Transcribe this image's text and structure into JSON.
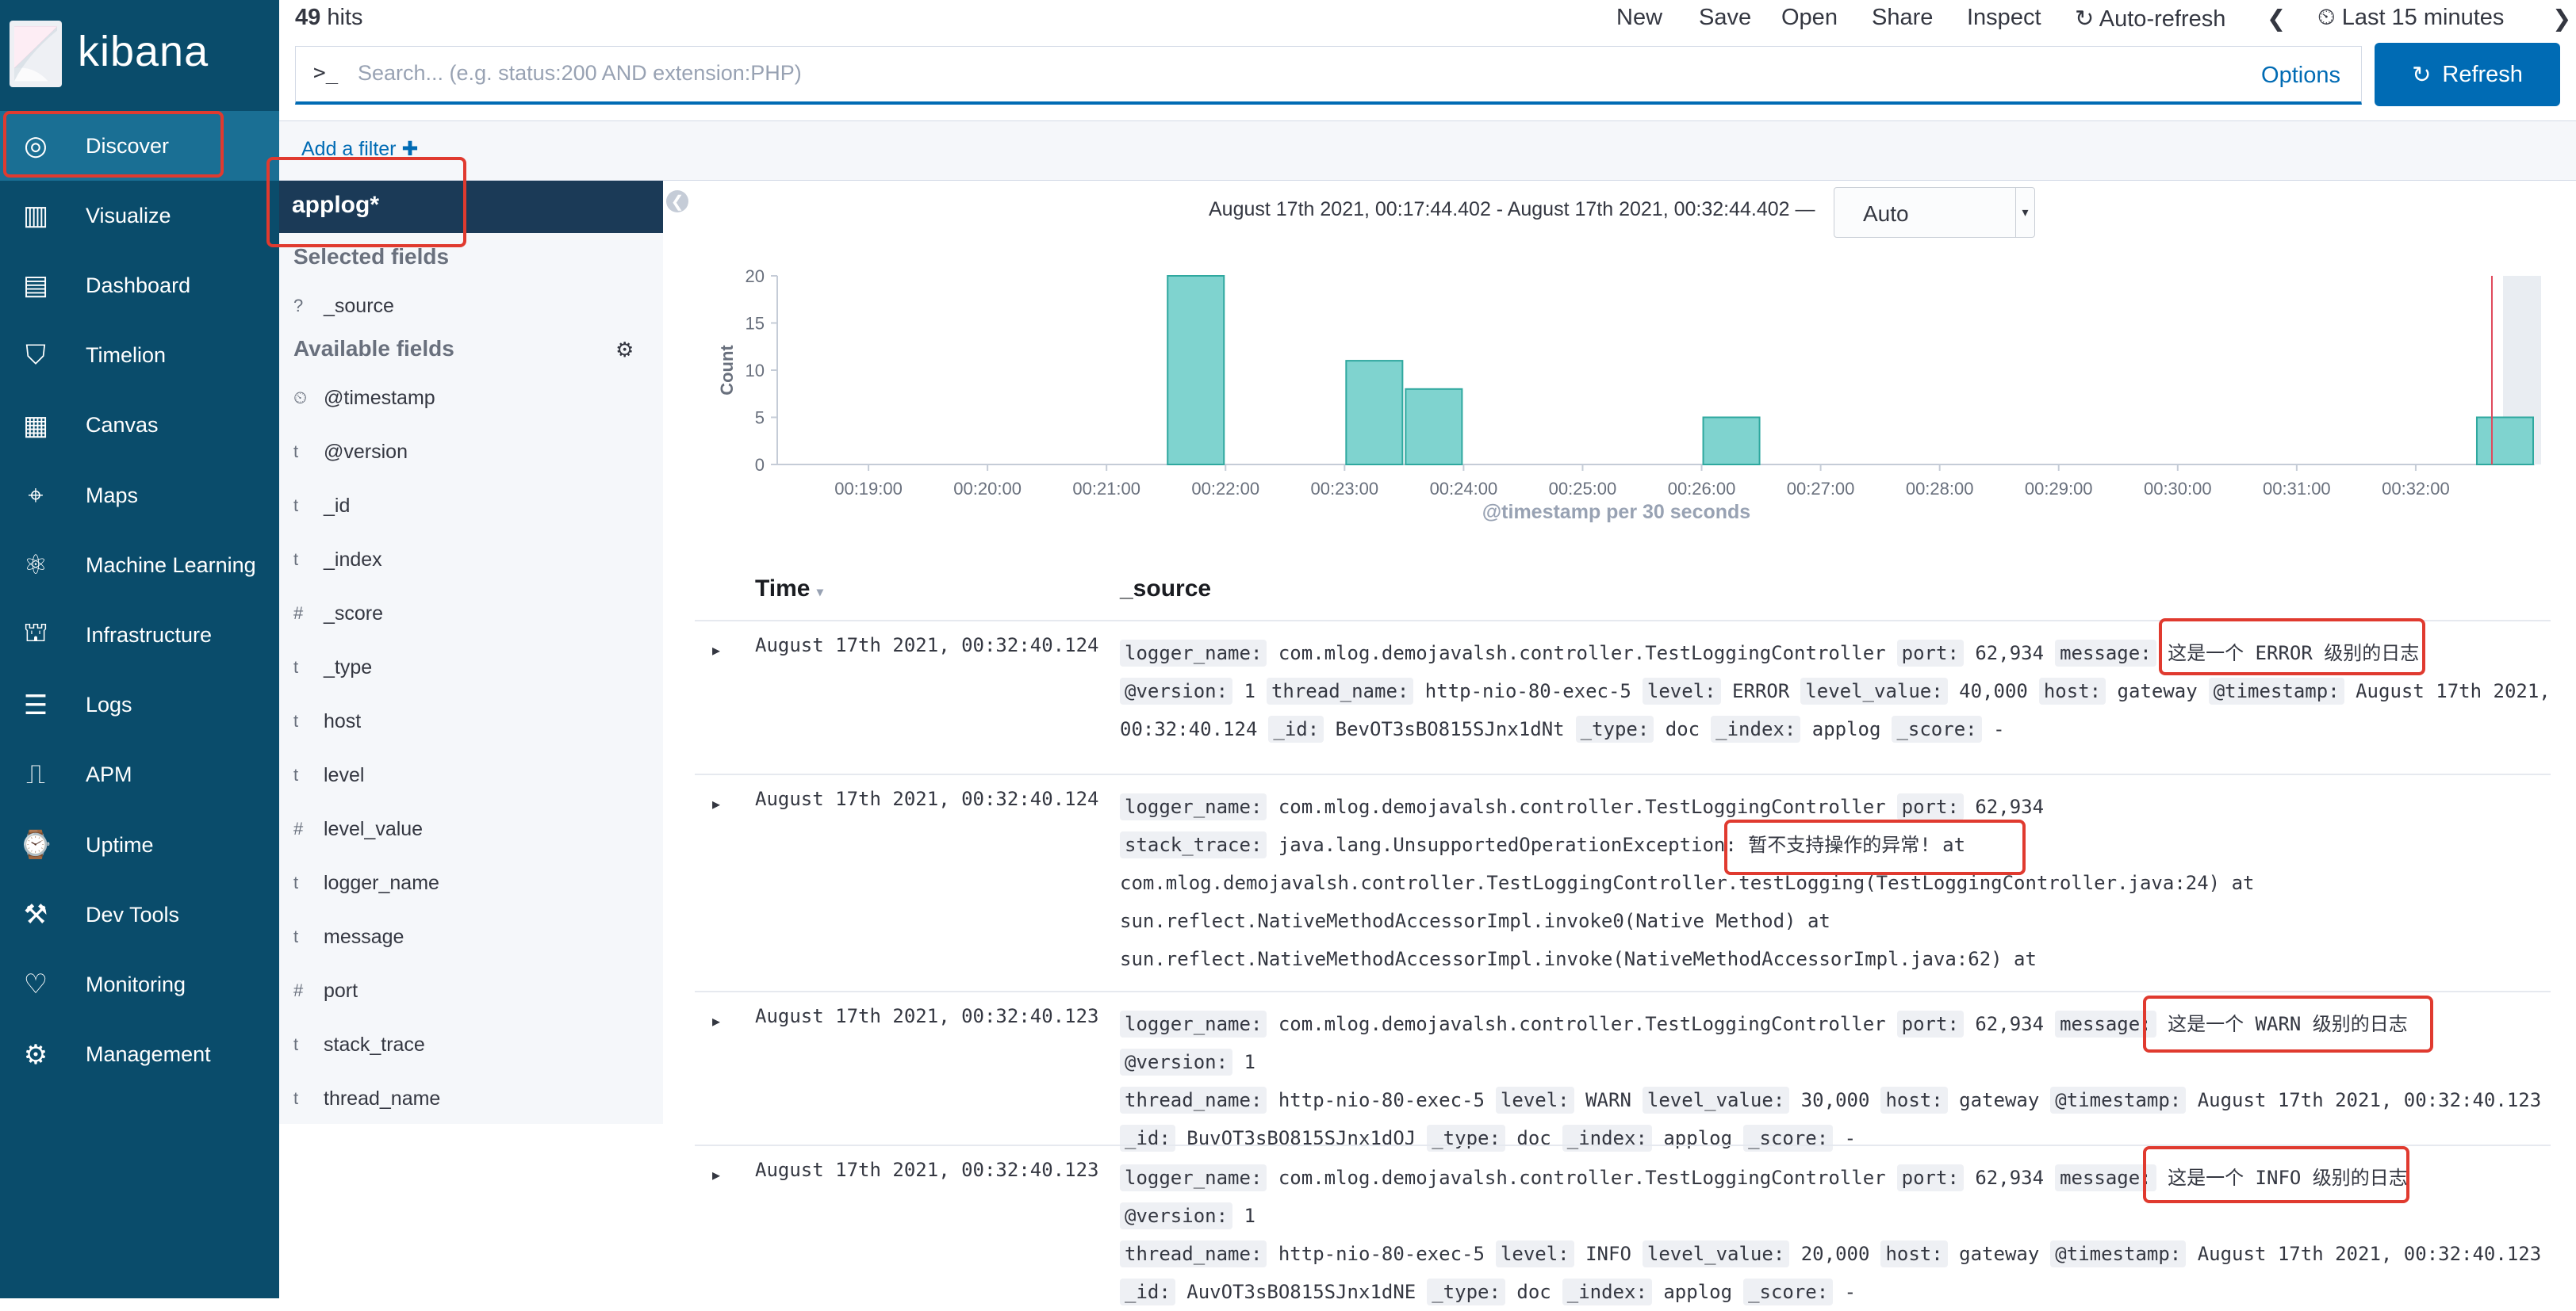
{
  "nav": {
    "logo_text": "kibana",
    "items": [
      {
        "label": "Discover",
        "icon": "compass-icon"
      },
      {
        "label": "Visualize",
        "icon": "visualize-icon"
      },
      {
        "label": "Dashboard",
        "icon": "dashboard-icon"
      },
      {
        "label": "Timelion",
        "icon": "timelion-icon"
      },
      {
        "label": "Canvas",
        "icon": "canvas-icon"
      },
      {
        "label": "Maps",
        "icon": "maps-icon"
      },
      {
        "label": "Machine Learning",
        "icon": "machine-learning-icon"
      },
      {
        "label": "Infrastructure",
        "icon": "infrastructure-icon"
      },
      {
        "label": "Logs",
        "icon": "logs-icon"
      },
      {
        "label": "APM",
        "icon": "apm-icon"
      },
      {
        "label": "Uptime",
        "icon": "uptime-icon"
      },
      {
        "label": "Dev Tools",
        "icon": "dev-tools-icon"
      },
      {
        "label": "Monitoring",
        "icon": "monitoring-icon"
      },
      {
        "label": "Management",
        "icon": "gear-icon"
      }
    ]
  },
  "topbar": {
    "hits_count": "49",
    "hits_label": "hits",
    "new": "New",
    "save": "Save",
    "open": "Open",
    "share": "Share",
    "inspect": "Inspect",
    "auto_refresh": "Auto-refresh",
    "time_range": "Last 15 minutes"
  },
  "search": {
    "prompt": ">_",
    "placeholder": "Search... (e.g. status:200 AND extension:PHP)",
    "options": "Options",
    "refresh": "Refresh"
  },
  "filters": {
    "add": "Add a filter"
  },
  "sidebar": {
    "index": "applog*",
    "selected_title": "Selected fields",
    "selected": [
      {
        "type": "?",
        "name": "_source"
      }
    ],
    "available_title": "Available fields",
    "available": [
      {
        "type": "clock",
        "name": "@timestamp"
      },
      {
        "type": "t",
        "name": "@version"
      },
      {
        "type": "t",
        "name": "_id"
      },
      {
        "type": "t",
        "name": "_index"
      },
      {
        "type": "#",
        "name": "_score"
      },
      {
        "type": "t",
        "name": "_type"
      },
      {
        "type": "t",
        "name": "host"
      },
      {
        "type": "t",
        "name": "level"
      },
      {
        "type": "#",
        "name": "level_value"
      },
      {
        "type": "t",
        "name": "logger_name"
      },
      {
        "type": "t",
        "name": "message"
      },
      {
        "type": "#",
        "name": "port"
      },
      {
        "type": "t",
        "name": "stack_trace"
      },
      {
        "type": "t",
        "name": "thread_name"
      }
    ]
  },
  "histogram": {
    "range_text": "August 17th 2021, 00:17:44.402 - August 17th 2021, 00:32:44.402 —",
    "interval": "Auto"
  },
  "chart_data": {
    "type": "bar",
    "ylabel": "Count",
    "xlabel": "@timestamp per 30 seconds",
    "ylim": [
      0,
      20
    ],
    "yticks": [
      0,
      5,
      10,
      15,
      20
    ],
    "xticks": [
      "00:19:00",
      "00:20:00",
      "00:21:00",
      "00:22:00",
      "00:23:00",
      "00:24:00",
      "00:25:00",
      "00:26:00",
      "00:27:00",
      "00:28:00",
      "00:29:00",
      "00:30:00",
      "00:31:00",
      "00:32:00"
    ],
    "categories": [
      "00:21:30",
      "00:23:00",
      "00:23:30",
      "00:26:00",
      "00:32:30"
    ],
    "values": [
      20,
      11,
      8,
      5,
      5
    ],
    "bar_color": "#7fd3cf",
    "grid": false
  },
  "table": {
    "col_time": "Time",
    "col_source": "_source",
    "rows": [
      {
        "time": "August 17th 2021, 00:32:40.124",
        "lines": [
          [
            [
              "logger_name:",
              "com.mlog.demojavalsh.controller.TestLoggingController"
            ],
            [
              "port:",
              "62,934"
            ],
            [
              "message:",
              "这是一个 ERROR 级别的日志"
            ]
          ],
          [
            [
              "@version:",
              "1"
            ],
            [
              "thread_name:",
              "http-nio-80-exec-5"
            ],
            [
              "level:",
              "ERROR"
            ],
            [
              "level_value:",
              "40,000"
            ],
            [
              "host:",
              "gateway"
            ],
            [
              "@timestamp:",
              "August 17th 2021,"
            ]
          ],
          [
            [
              "",
              "00:32:40.124"
            ],
            [
              "_id:",
              "BevOT3sBO815SJnx1dNt"
            ],
            [
              "_type:",
              "doc"
            ],
            [
              "_index:",
              "applog"
            ],
            [
              "_score:",
              "-"
            ]
          ]
        ]
      },
      {
        "time": "August 17th 2021, 00:32:40.124",
        "lines": [
          [
            [
              "logger_name:",
              "com.mlog.demojavalsh.controller.TestLoggingController"
            ],
            [
              "port:",
              "62,934"
            ]
          ],
          [
            [
              "stack_trace:",
              "java.lang.UnsupportedOperationException: 暂不支持操作的异常! at"
            ]
          ],
          [
            [
              "",
              "com.mlog.demojavalsh.controller.TestLoggingController.testLogging(TestLoggingController.java:24) at"
            ]
          ],
          [
            [
              "",
              "sun.reflect.NativeMethodAccessorImpl.invoke0(Native Method) at"
            ]
          ],
          [
            [
              "",
              "sun.reflect.NativeMethodAccessorImpl.invoke(NativeMethodAccessorImpl.java:62) at"
            ]
          ]
        ]
      },
      {
        "time": "August 17th 2021, 00:32:40.123",
        "lines": [
          [
            [
              "logger_name:",
              "com.mlog.demojavalsh.controller.TestLoggingController"
            ],
            [
              "port:",
              "62,934"
            ],
            [
              "message:",
              "这是一个 WARN 级别的日志"
            ],
            [
              "@version:",
              "1"
            ]
          ],
          [
            [
              "thread_name:",
              "http-nio-80-exec-5"
            ],
            [
              "level:",
              "WARN"
            ],
            [
              "level_value:",
              "30,000"
            ],
            [
              "host:",
              "gateway"
            ],
            [
              "@timestamp:",
              "August 17th 2021, 00:32:40.123"
            ]
          ],
          [
            [
              "_id:",
              "BuvOT3sBO815SJnx1dOJ"
            ],
            [
              "_type:",
              "doc"
            ],
            [
              "_index:",
              "applog"
            ],
            [
              "_score:",
              "-"
            ]
          ]
        ]
      },
      {
        "time": "August 17th 2021, 00:32:40.123",
        "lines": [
          [
            [
              "logger_name:",
              "com.mlog.demojavalsh.controller.TestLoggingController"
            ],
            [
              "port:",
              "62,934"
            ],
            [
              "message:",
              "这是一个 INFO 级别的日志"
            ],
            [
              "@version:",
              "1"
            ]
          ],
          [
            [
              "thread_name:",
              "http-nio-80-exec-5"
            ],
            [
              "level:",
              "INFO"
            ],
            [
              "level_value:",
              "20,000"
            ],
            [
              "host:",
              "gateway"
            ],
            [
              "@timestamp:",
              "August 17th 2021, 00:32:40.123"
            ]
          ],
          [
            [
              "_id:",
              "AuvOT3sBO815SJnx1dNE"
            ],
            [
              "_type:",
              "doc"
            ],
            [
              "_index:",
              "applog"
            ],
            [
              "_score:",
              "-"
            ]
          ]
        ]
      }
    ]
  }
}
